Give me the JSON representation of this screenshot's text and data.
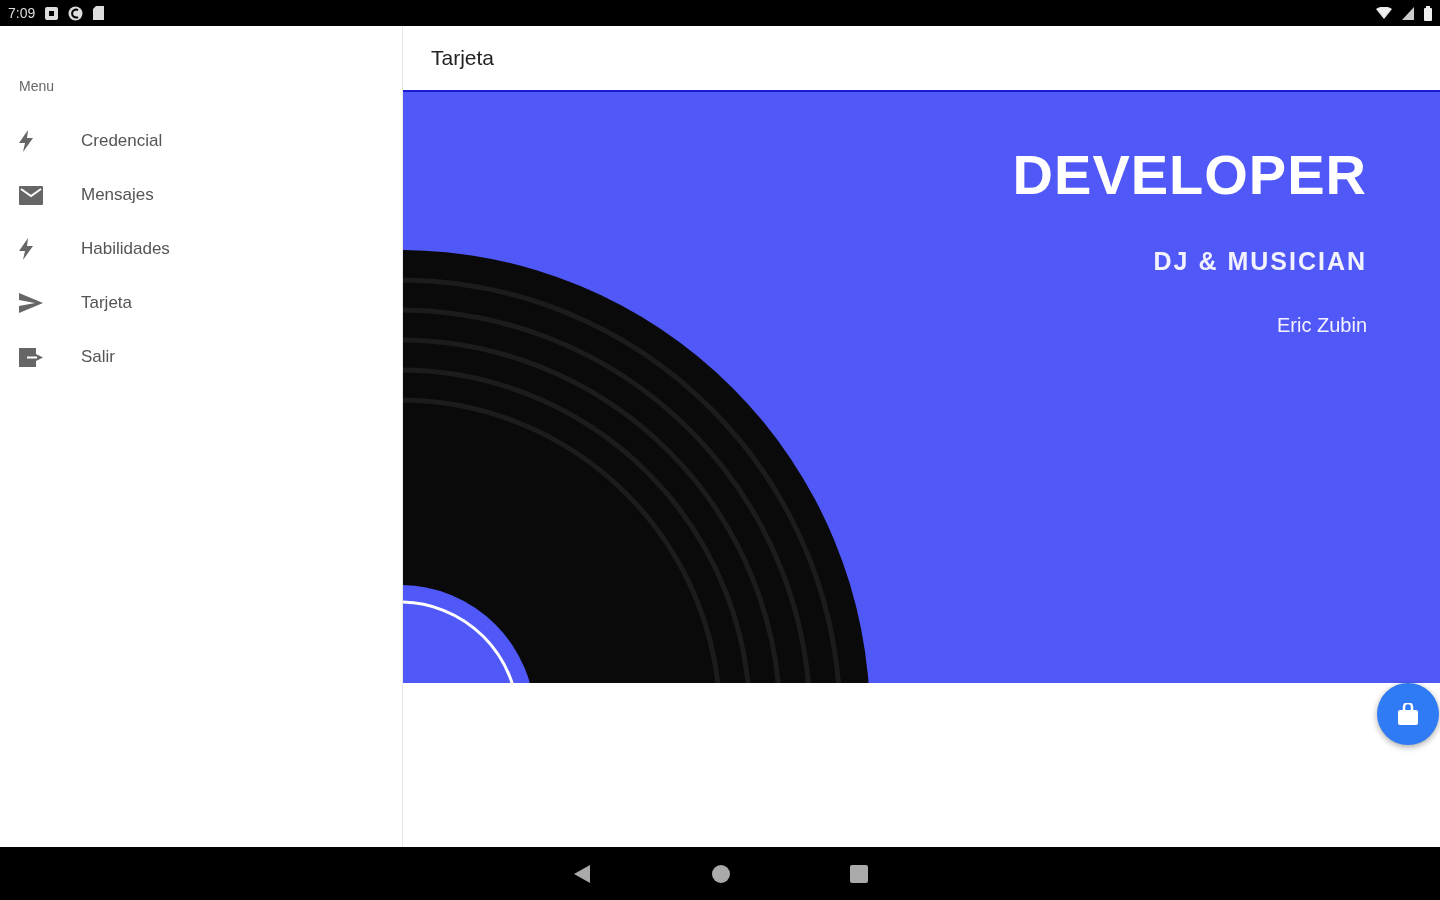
{
  "status_bar": {
    "time": "7:09"
  },
  "sidebar": {
    "heading": "Menu",
    "items": [
      {
        "label": "Credencial"
      },
      {
        "label": "Mensajes"
      },
      {
        "label": "Habilidades"
      },
      {
        "label": "Tarjeta"
      },
      {
        "label": "Salir"
      }
    ]
  },
  "header": {
    "title": "Tarjeta"
  },
  "card": {
    "title": "DEVELOPER",
    "subtitle": "DJ & MUSICIAN",
    "name": "Eric Zubin"
  }
}
